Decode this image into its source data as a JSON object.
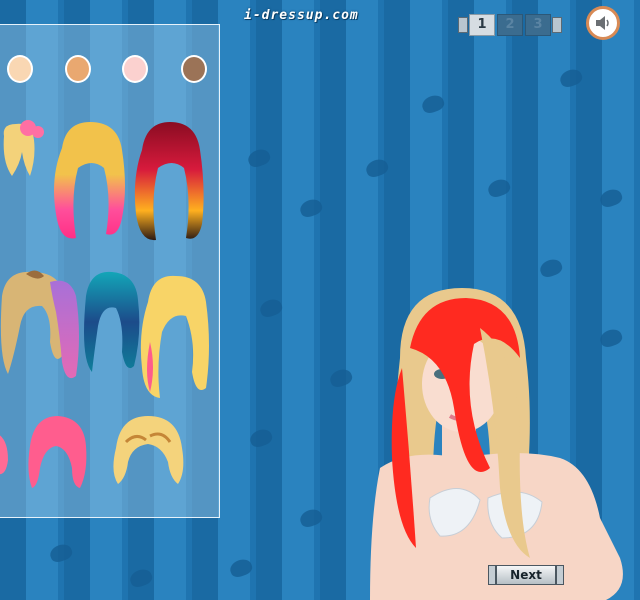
{
  "header": {
    "logo_text": "i-dressup.com"
  },
  "pager": {
    "pages": [
      "1",
      "2",
      "3"
    ],
    "active_page": "1"
  },
  "controls": {
    "sound_icon": "speaker-icon",
    "next_label": "Next"
  },
  "skin_tones": [
    "#f9d7b3",
    "#e9a870",
    "#fbd1cf",
    "#9b7357"
  ],
  "hairstyles": [
    {
      "name": "pink-bow-blonde",
      "colors": [
        "#f3d27a",
        "#ff6fa3"
      ]
    },
    {
      "name": "blonde-pink-ombre",
      "colors": [
        "#f2c24b",
        "#ff4f9b"
      ]
    },
    {
      "name": "red-orange-flame",
      "colors": [
        "#b3122e",
        "#ffb01f"
      ]
    },
    {
      "name": "tan-bun",
      "colors": [
        "#d8b575",
        "#9b6d3d"
      ]
    },
    {
      "name": "purple-highlight",
      "colors": [
        "#a870d8",
        "#e46ab5"
      ]
    },
    {
      "name": "blue-teal-waves",
      "colors": [
        "#1c4b8a",
        "#13a6b8"
      ]
    },
    {
      "name": "blonde-pink-streak",
      "colors": [
        "#f8d467",
        "#ff5c8c"
      ]
    },
    {
      "name": "pink-short",
      "colors": [
        "#ff6b94",
        "#ff9cb8"
      ]
    },
    {
      "name": "pink-bob",
      "colors": [
        "#ff5d8e",
        "#ff87a9"
      ]
    },
    {
      "name": "blonde-curly",
      "colors": [
        "#f4d37c",
        "#c58637"
      ]
    }
  ],
  "model": {
    "hair_base": "#e9c98d",
    "hair_streak": "#ff2a20",
    "skin": "#f7d6c6"
  }
}
